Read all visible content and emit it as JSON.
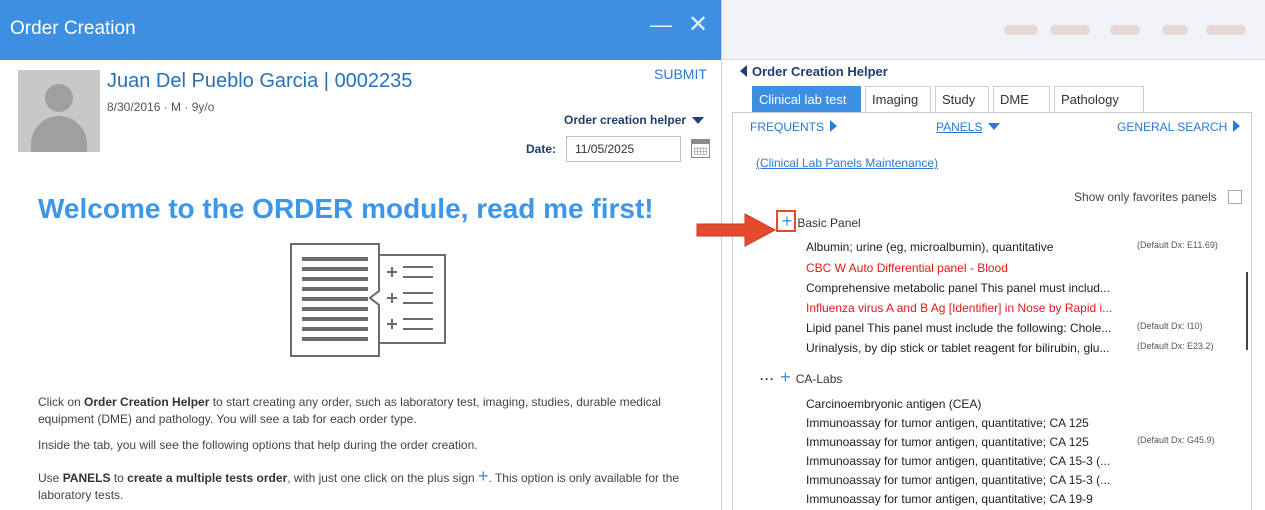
{
  "window": {
    "title": "Order Creation",
    "minimize_glyph": "—",
    "close_glyph": "✕"
  },
  "patient": {
    "name": "Juan  Del Pueblo Garcia",
    "separator": "|",
    "id": "0002235",
    "info": "8/30/2016 · M · 9y/o"
  },
  "header": {
    "submit_label": "SUBMIT",
    "helper_dropdown_label": "Order creation helper",
    "date_label": "Date:",
    "date_value": "11/05/2025"
  },
  "welcome": {
    "title": "Welcome to the ORDER module, read me first!",
    "p1_prefix": "Click on ",
    "p1_bold": "Order Creation Helper",
    "p1_suffix": " to start creating any order, such as laboratory test, imaging, studies, durable medical equipment (DME) and pathology. You will see a tab for each order type.",
    "p2": "Inside the tab, you will see the following options that help during the order creation.",
    "p3_prefix": "Use ",
    "p3_bold1": "PANELS",
    "p3_mid": " to ",
    "p3_bold2": "create a multiple tests order",
    "p3_mid2": ", with just one click on the plus sign ",
    "p3_plus": "+",
    "p3_suffix": ". This option is only available for the laboratory tests."
  },
  "helper": {
    "title": "Order Creation Helper",
    "tabs": [
      {
        "label": "Clinical lab test",
        "active": true
      },
      {
        "label": "Imaging",
        "active": false
      },
      {
        "label": "Study",
        "active": false
      },
      {
        "label": "DME",
        "active": false
      },
      {
        "label": "Pathology",
        "active": false
      }
    ],
    "frequents_label": "FREQUENTS",
    "panels_label": "PANELS",
    "general_search_label": "GENERAL SEARCH",
    "maintenance_link": "(Clinical Lab Panels Maintenance)",
    "favorites_label": "Show only favorites panels",
    "favorites_checked": false,
    "groups": [
      {
        "name": "Basic Panel",
        "items": [
          {
            "label": "Albumin; urine (eg, microalbumin), quantitative",
            "dx": "(Default Dx: E11.69)",
            "red": false
          },
          {
            "label": "CBC W Auto Differential panel - Blood",
            "dx": "",
            "red": true
          },
          {
            "label": "Comprehensive metabolic panel This panel must includ...",
            "dx": "",
            "red": false
          },
          {
            "label": "Influenza virus A and B Ag [Identifier] in Nose by Rapid i...",
            "dx": "",
            "red": true
          },
          {
            "label": "Lipid panel This panel must include the following: Chole...",
            "dx": "(Default Dx: I10)",
            "red": false
          },
          {
            "label": "Urinalysis, by dip stick or tablet reagent for bilirubin, glu...",
            "dx": "(Default Dx: E23.2)",
            "red": false
          }
        ]
      },
      {
        "name": "CA-Labs",
        "items": [
          {
            "label": "Carcinoembryonic antigen (CEA)",
            "dx": "",
            "red": false
          },
          {
            "label": "Immunoassay for tumor antigen, quantitative; CA 125",
            "dx": "",
            "red": false
          },
          {
            "label": "Immunoassay for tumor antigen, quantitative; CA 125",
            "dx": "(Default Dx: G45.9)",
            "red": false
          },
          {
            "label": "Immunoassay for tumor antigen, quantitative; CA 15-3 (...",
            "dx": "",
            "red": false
          },
          {
            "label": "Immunoassay for tumor antigen, quantitative; CA 15-3 (...",
            "dx": "",
            "red": false
          },
          {
            "label": "Immunoassay for tumor antigen, quantitative; CA 19-9",
            "dx": "",
            "red": false
          }
        ]
      }
    ],
    "dots": "···",
    "plus_glyph": "+"
  },
  "colors": {
    "titlebar": "#3d8fe1",
    "accent_blue": "#3d96e8",
    "link_blue": "#2a79d4",
    "navy": "#1f3d6e",
    "alert_red": "#e01a1a",
    "annotation_red": "#e64a2e"
  },
  "icons": {
    "calendar": "calendar-icon",
    "document": "document-list-icon",
    "annotation": "red-arrow-icon"
  }
}
